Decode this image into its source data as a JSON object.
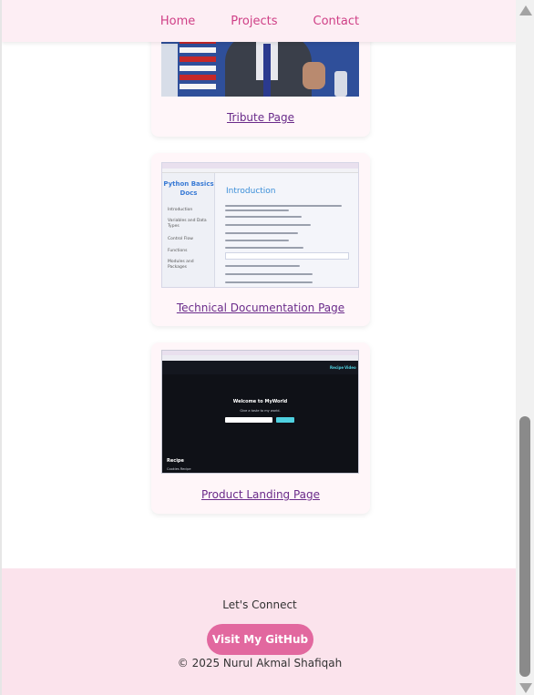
{
  "nav": {
    "home": "Home",
    "projects": "Projects",
    "contact": "Contact"
  },
  "projects": {
    "tribute": {
      "link": "Tribute Page"
    },
    "docs": {
      "link": "Technical Documentation Page",
      "thumb": {
        "sidebar_title": "Python Basics Docs",
        "sidebar_items": [
          "Introduction",
          "Variables and Data Types",
          "Control Flow",
          "Functions",
          "Modules and Packages"
        ],
        "main_title": "Introduction"
      }
    },
    "landing": {
      "link": "Product Landing Page",
      "thumb": {
        "nav_items": [
          "Recipe",
          "Video"
        ],
        "heading": "Welcome to MyWorld",
        "subheading": "Give a taste to my world.",
        "button": "Get Started",
        "section": "Recipe",
        "section_item": "Cookies Recipe"
      }
    }
  },
  "footer": {
    "heading": "Let's Connect",
    "github_button": "Visit My GitHub",
    "copyright": "© 2025 Nurul Akmal Shafiqah"
  },
  "colors": {
    "nav_bg": "#fdeef4",
    "nav_link": "#cf3f86",
    "card_link": "#6a2b8a",
    "footer_bg": "#fbe3ec",
    "button_bg": "#e2689f"
  }
}
